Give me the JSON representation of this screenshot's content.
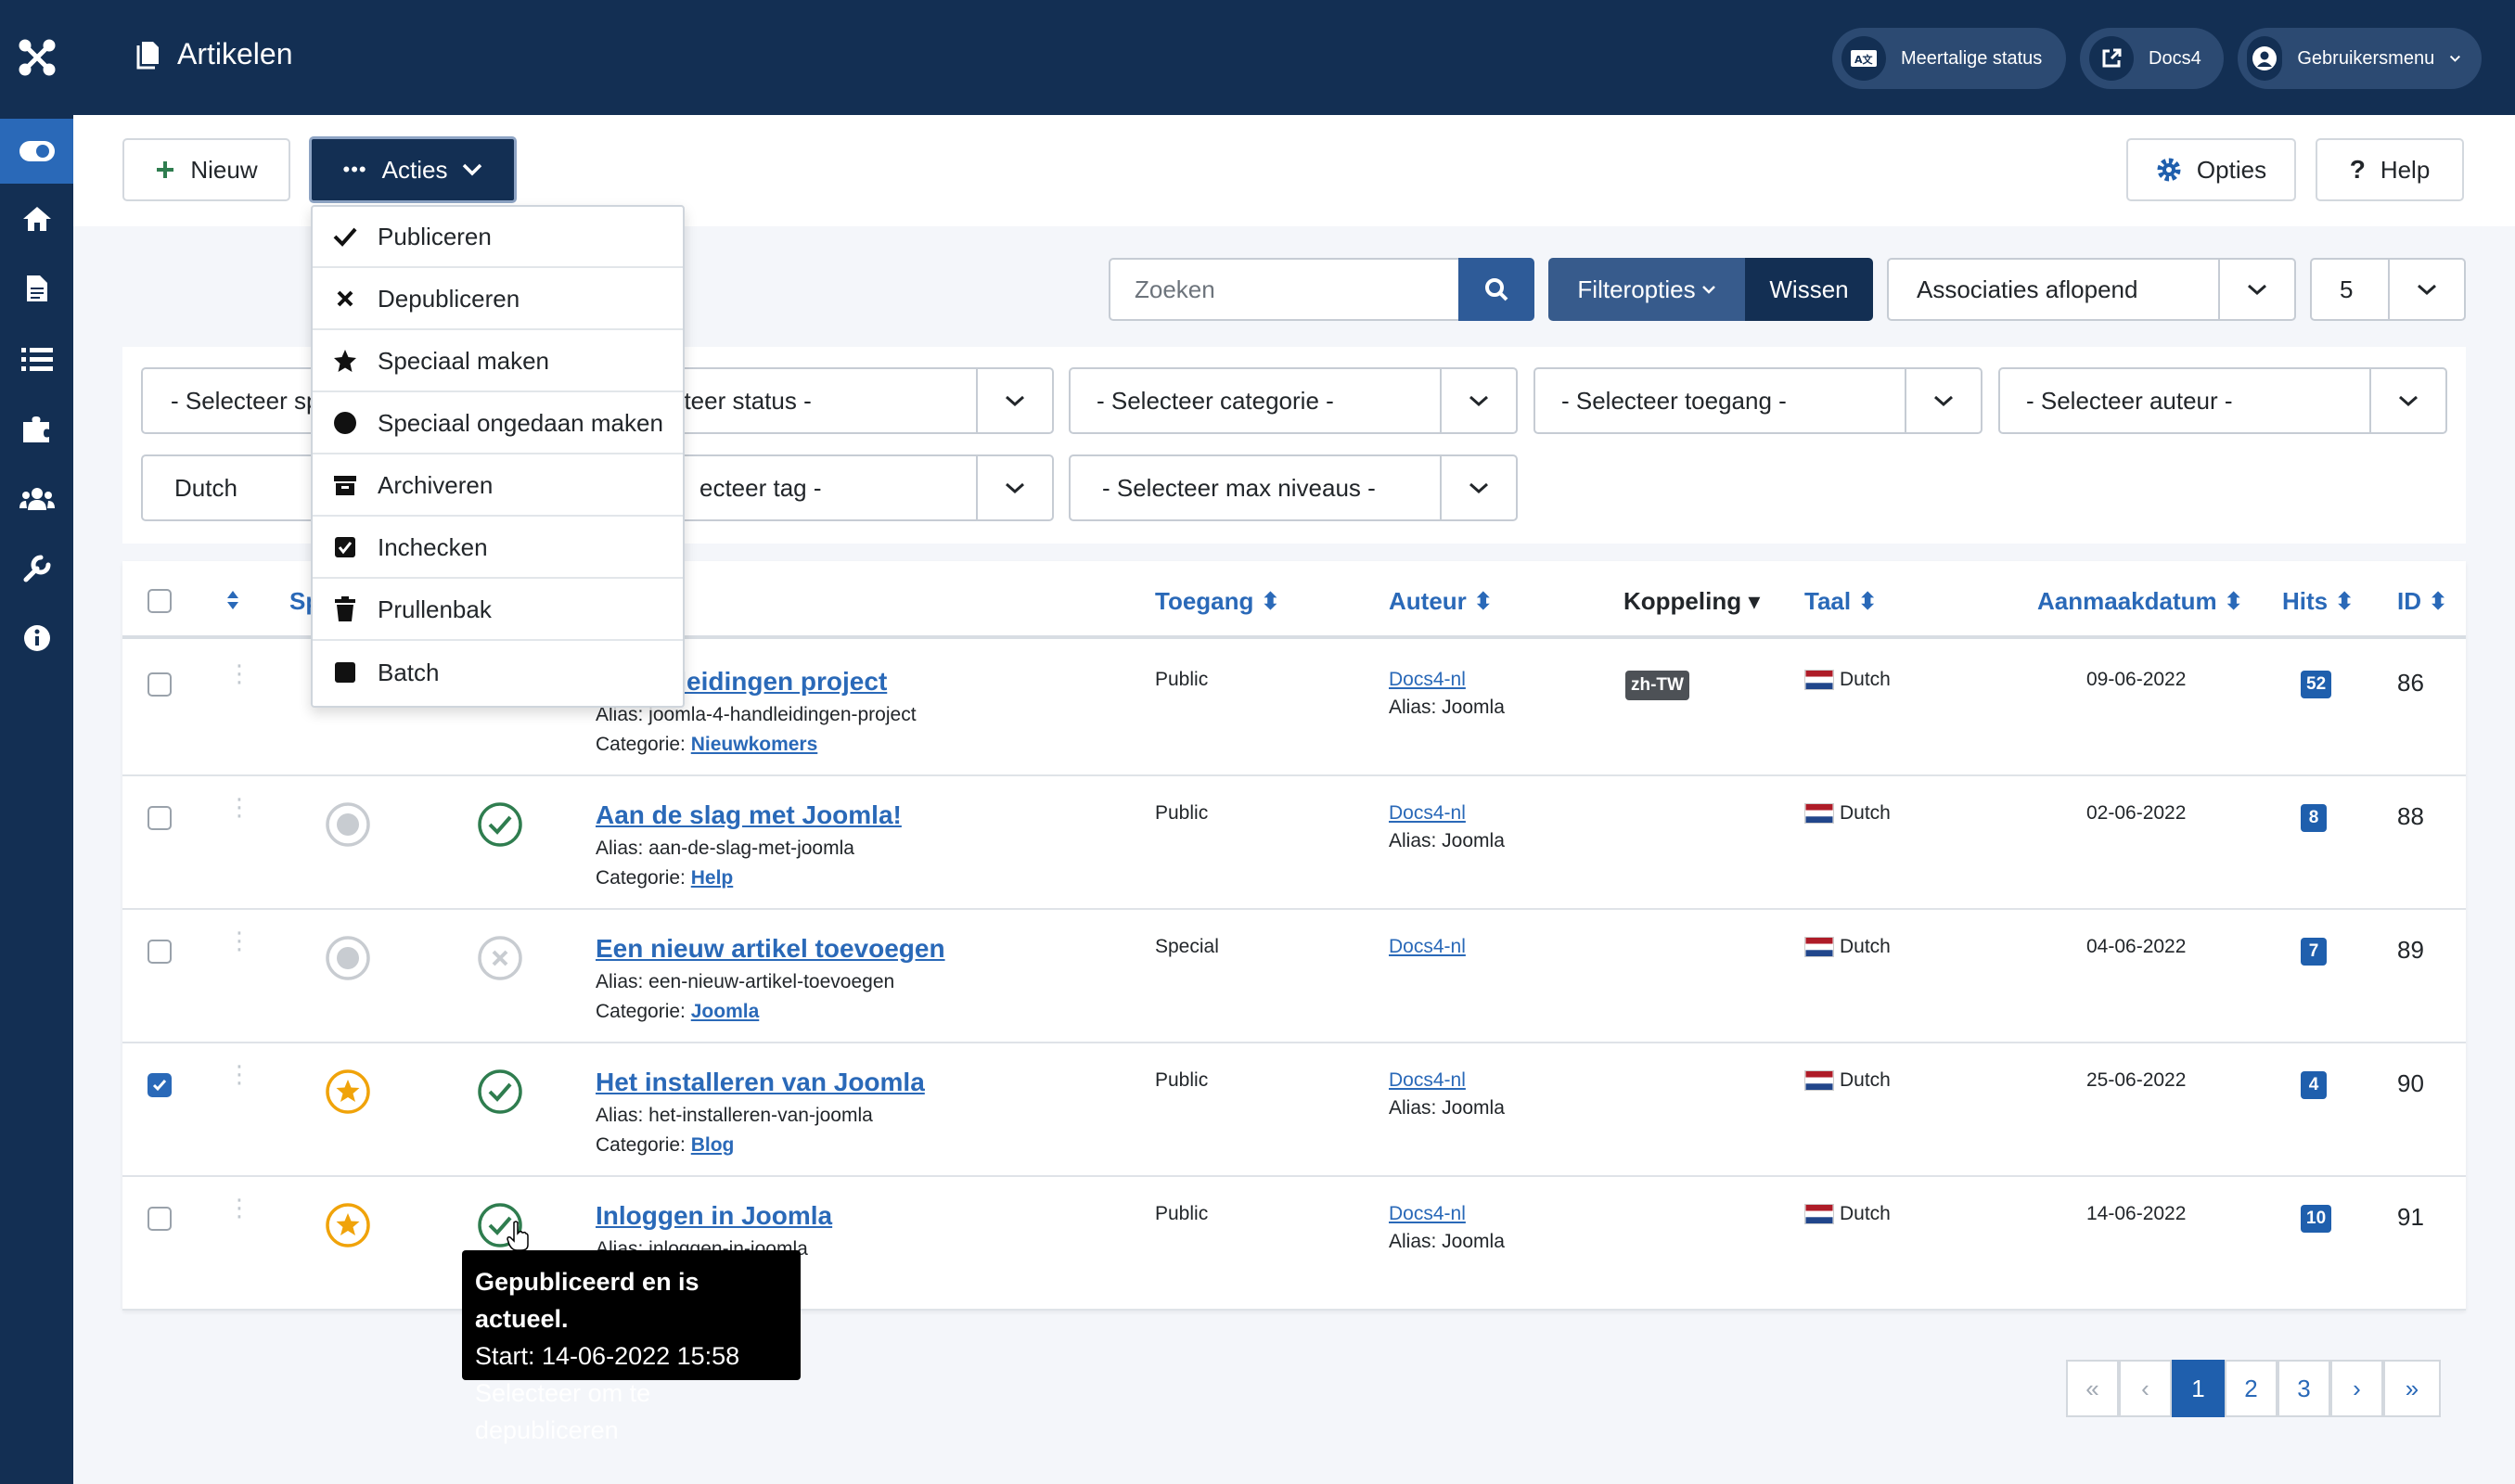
{
  "app": {
    "title": "Artikelen"
  },
  "header": {
    "multilang": "Meertalige status",
    "docs": "Docs4",
    "usermenu": "Gebruikersmenu"
  },
  "toolbar": {
    "new": "Nieuw",
    "actions": "Acties",
    "options": "Opties",
    "help": "Help"
  },
  "actions_menu": [
    "Publiceren",
    "Depubliceren",
    "Speciaal maken",
    "Speciaal ongedaan maken",
    "Archiveren",
    "Inchecken",
    "Prullenbak",
    "Batch"
  ],
  "search": {
    "placeholder": "Zoeken",
    "filter_options": "Filteropties",
    "clear": "Wissen",
    "sort": "Associaties aflopend",
    "limit": "5"
  },
  "filters": {
    "featured": "- Selecteer sp",
    "status": "ecteer status -",
    "category": "- Selecteer categorie -",
    "access": "- Selecteer toegang -",
    "author": "- Selecteer auteur -",
    "language": "Dutch",
    "tag": "ecteer tag -",
    "maxlevels": "- Selecteer max niveaus -"
  },
  "columns": {
    "featured_abbr": "Sp",
    "access": "Toegang",
    "author": "Auteur",
    "association": "Koppeling",
    "language": "Taal",
    "created": "Aanmaakdatum",
    "hits": "Hits",
    "id": "ID"
  },
  "rows": [
    {
      "title": "4 handleidingen project",
      "alias": "Alias: joomla-4-handleidingen-project",
      "category_label": "Categorie:",
      "category": "Nieuwkomers",
      "access": "Public",
      "author": "Docs4-nl",
      "author_alias": "Alias: Joomla",
      "association": "zh-TW",
      "language": "Dutch",
      "date": "09-06-2022",
      "hits": "52",
      "id": "86",
      "checked": false,
      "featured": "none",
      "published": "none"
    },
    {
      "title": "Aan de slag met Joomla!",
      "alias": "Alias: aan-de-slag-met-joomla",
      "category_label": "Categorie:",
      "category": "Help",
      "access": "Public",
      "author": "Docs4-nl",
      "author_alias": "Alias: Joomla",
      "association": "",
      "language": "Dutch",
      "date": "02-06-2022",
      "hits": "8",
      "id": "88",
      "checked": false,
      "featured": "no",
      "published": "yes"
    },
    {
      "title": "Een nieuw artikel toevoegen",
      "alias": "Alias: een-nieuw-artikel-toevoegen",
      "category_label": "Categorie:",
      "category": "Joomla",
      "access": "Special",
      "author": "Docs4-nl",
      "author_alias": "",
      "association": "",
      "language": "Dutch",
      "date": "04-06-2022",
      "hits": "7",
      "id": "89",
      "checked": false,
      "featured": "no",
      "published": "no"
    },
    {
      "title": "Het installeren van Joomla",
      "alias": "Alias: het-installeren-van-joomla",
      "category_label": "Categorie:",
      "category": "Blog",
      "access": "Public",
      "author": "Docs4-nl",
      "author_alias": "Alias: Joomla",
      "association": "",
      "language": "Dutch",
      "date": "25-06-2022",
      "hits": "4",
      "id": "90",
      "checked": true,
      "featured": "yes",
      "published": "yes"
    },
    {
      "title": "Inloggen in Joomla",
      "alias": "Alias: inloggen-in-joomla",
      "category_label": "",
      "category": "",
      "access": "Public",
      "author": "Docs4-nl",
      "author_alias": "Alias: Joomla",
      "association": "",
      "language": "Dutch",
      "date": "14-06-2022",
      "hits": "10",
      "id": "91",
      "checked": false,
      "featured": "yes",
      "published": "yes"
    }
  ],
  "tooltip": {
    "line1": "Gepubliceerd en is actueel.",
    "line2": "Start: 14-06-2022 15:58",
    "line3": "Selecteer om te depubliceren"
  },
  "pagination": {
    "first": "«",
    "prev": "‹",
    "pages": [
      "1",
      "2",
      "3"
    ],
    "next": "›",
    "last": "»"
  },
  "colors": {
    "navy": "#132f53",
    "blue": "#2a69b8",
    "green": "#2f7d4f",
    "gold": "#f0a30a"
  }
}
